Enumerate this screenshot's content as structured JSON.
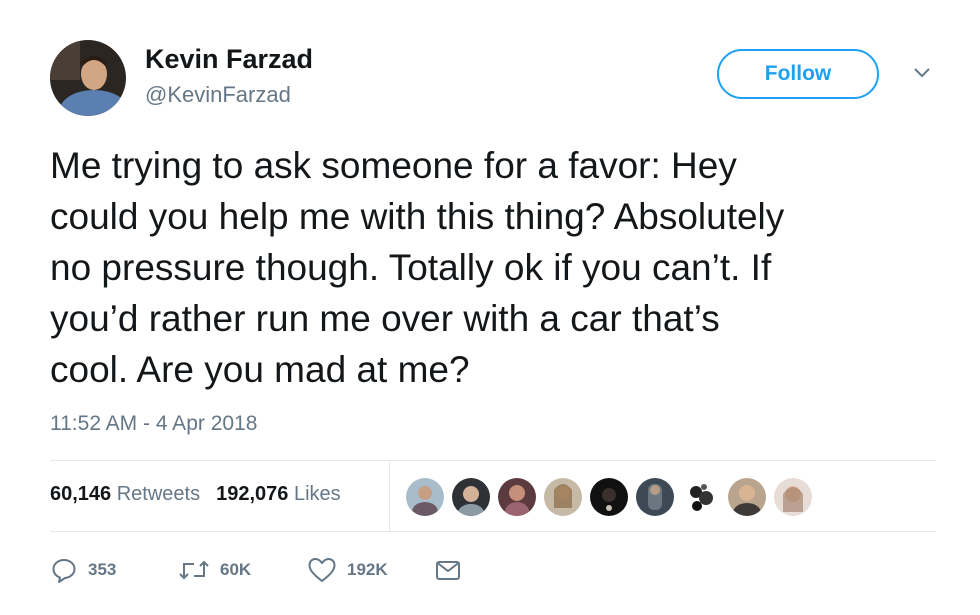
{
  "user": {
    "name": "Kevin Farzad",
    "handle": "@KevinFarzad",
    "avatar": "profile-photo"
  },
  "follow_label": "Follow",
  "tweet": {
    "lines": [
      "Me trying to ask someone for a favor: Hey",
      "could you help me with this thing? Absolutely",
      "no pressure though. Totally ok if you can’t. If",
      "you’d rather run me over with a car that’s",
      "cool. Are you mad at me?"
    ],
    "timestamp": "11:52 AM - 4 Apr 2018"
  },
  "stats": {
    "retweets_count": "60,146",
    "retweets_label": "Retweets",
    "likes_count": "192,076",
    "likes_label": "Likes"
  },
  "likers": [
    "liker-avatar",
    "liker-avatar",
    "liker-avatar",
    "liker-avatar",
    "liker-avatar",
    "liker-avatar",
    "liker-avatar",
    "liker-avatar",
    "liker-avatar"
  ],
  "actions": {
    "reply_count": "353",
    "retweet_count": "60K",
    "like_count": "192K"
  },
  "colors": {
    "accent": "#1da1f2",
    "muted": "#657786",
    "text": "#14171a",
    "divider": "#e1e8ed"
  }
}
